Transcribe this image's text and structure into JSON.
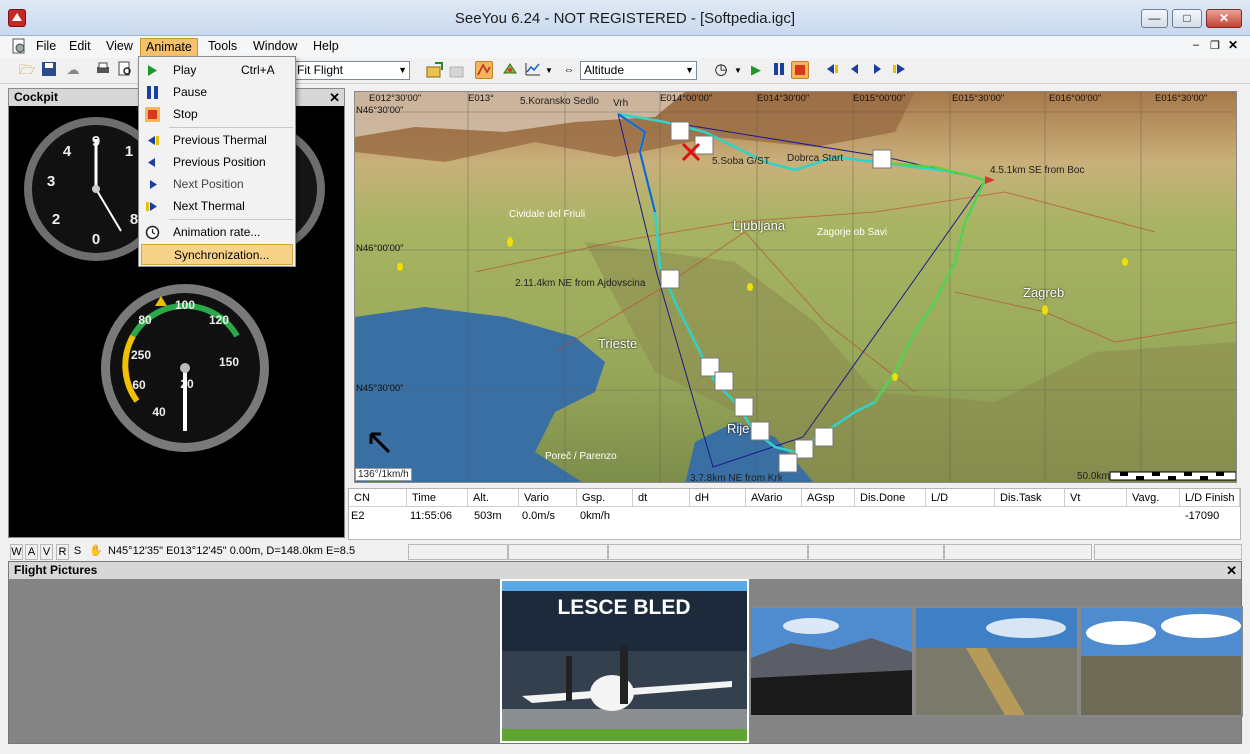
{
  "window": {
    "title": "SeeYou 6.24 - NOT REGISTERED - [Softpedia.igc]"
  },
  "menubar": {
    "items": [
      "File",
      "Edit",
      "View",
      "Animate",
      "Tools",
      "Window",
      "Help"
    ]
  },
  "animate_menu": {
    "play": "Play",
    "play_shortcut": "Ctrl+A",
    "pause": "Pause",
    "stop": "Stop",
    "previous_thermal": "Previous Thermal",
    "previous_position": "Previous Position",
    "next_position": "Next Position",
    "next_thermal": "Next Thermal",
    "animation_rate": "Animation rate...",
    "synchronization": "Synchronization..."
  },
  "toolbar": {
    "view_combo": "Fit Flight",
    "graph_combo": "Altitude"
  },
  "cockpit": {
    "title": "Cockpit"
  },
  "map": {
    "coords_top": [
      "E012°30'00\"",
      "E013°",
      "E014°00'00\"",
      "E014°30'00\"",
      "E015°00'00\"",
      "E015°30'00\"",
      "E016°00'00\"",
      "E016°30'00\""
    ],
    "coords_left": [
      "N46°30'00\"",
      "N46°00'00\"",
      "N45°30'00\""
    ],
    "cities": [
      "Ljubljana",
      "Zagreb",
      "Trieste",
      "Rije"
    ],
    "towns": [
      "Cividale del Friuli",
      "Zagorje ob Savi",
      "Poreč / Parenzo"
    ],
    "turnpoints": {
      "tp5": "5.Koransko Sedlo",
      "tp_vrh": "Vrh",
      "start": "Dobrca Start",
      "start_other": "5.Soba G/ST",
      "tp4": "4.5.1km SE from Boc",
      "tp2": "2.11.4km NE from Ajdovscina",
      "tp3": "3.7.8km NE from Krk"
    },
    "heading": "136°/1km/h",
    "scale": "50.0km"
  },
  "table": {
    "headers": [
      "CN",
      "Time",
      "Alt.",
      "Vario",
      "Gsp.",
      "dt",
      "dH",
      "AVario",
      "AGsp",
      "Dis.Done",
      "L/D",
      "Dis.Task",
      "Vt",
      "Vavg.",
      "L/D Finish"
    ],
    "row": {
      "cn": "E2",
      "time": "11:55:06",
      "alt": "503m",
      "vario": "0.0m/s",
      "gsp": "0km/h",
      "ld_finish": "-17090"
    }
  },
  "statusbar": {
    "buttons": [
      "W",
      "A",
      "V",
      "R",
      "S"
    ],
    "position": "N45°12'35\" E013°12'45\" 0.00m, D=148.0km E=8.5"
  },
  "pictures": {
    "title": "Flight Pictures",
    "hangar_sign": "LESCE  BLED"
  },
  "colors": {
    "menu_highlight": "#f5c26b",
    "map_water": "#3a6fa3",
    "track": "#2fd3c9"
  }
}
